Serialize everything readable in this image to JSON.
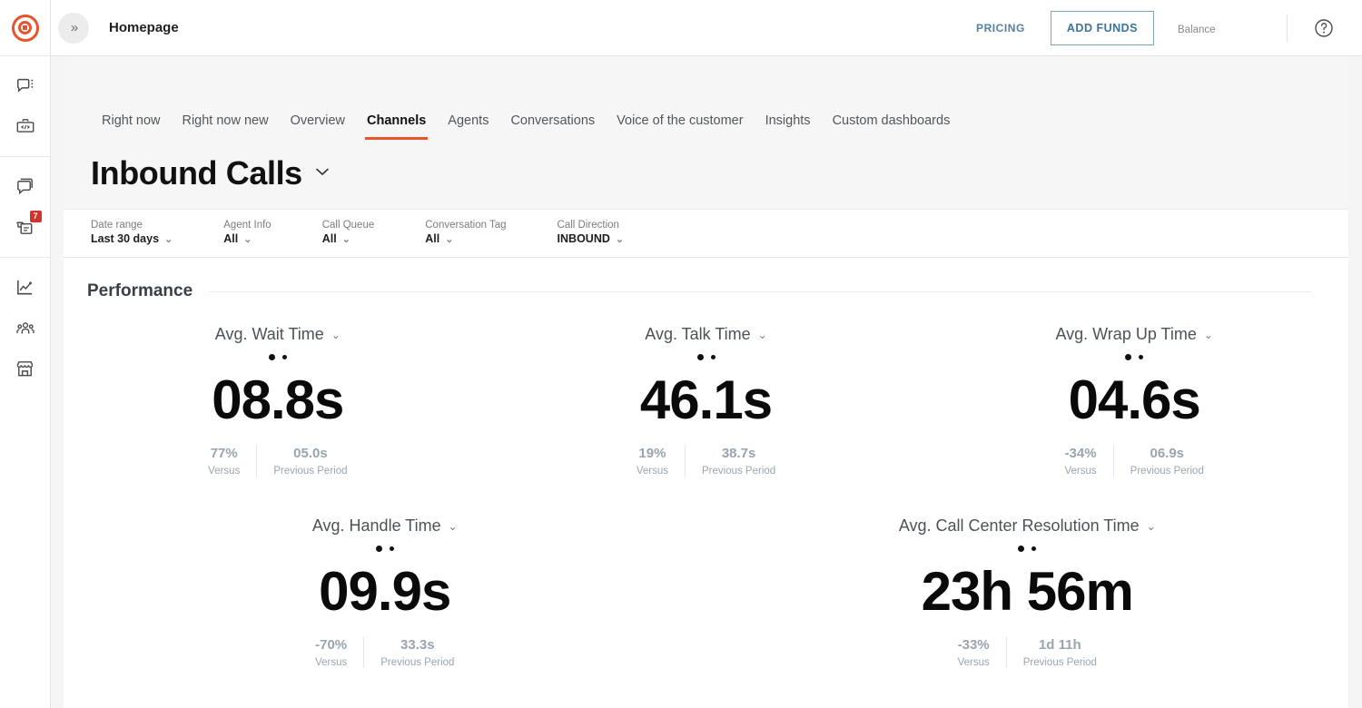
{
  "rail": {
    "logo": "target-logo",
    "groups": [
      {
        "items": [
          {
            "name": "chat-menu-icon",
            "icon": "chat-bubble-dots"
          },
          {
            "name": "developer-tools-icon",
            "icon": "briefcase-code"
          }
        ]
      },
      {
        "items": [
          {
            "name": "conversations-icon",
            "icon": "duplicate-chat"
          },
          {
            "name": "tickets-icon",
            "icon": "document-minus",
            "badge": "7"
          }
        ]
      },
      {
        "items": [
          {
            "name": "analytics-icon",
            "icon": "line-chart"
          },
          {
            "name": "team-icon",
            "icon": "people-group"
          },
          {
            "name": "marketplace-icon",
            "icon": "storefront"
          }
        ]
      }
    ]
  },
  "topbar": {
    "collapse_icon": "double-chevron-right",
    "breadcrumb": "Homepage",
    "pricing_label": "PRICING",
    "add_funds_label": "ADD FUNDS",
    "balance_label": "Balance",
    "balance_value": "",
    "help_icon": "question-circle",
    "accent_color": "#e8542a",
    "link_color": "#56829f"
  },
  "tabs": [
    {
      "label": "Right now",
      "active": false
    },
    {
      "label": "Right now new",
      "active": false
    },
    {
      "label": "Overview",
      "active": false
    },
    {
      "label": "Channels",
      "active": true
    },
    {
      "label": "Agents",
      "active": false
    },
    {
      "label": "Conversations",
      "active": false
    },
    {
      "label": "Voice of the customer",
      "active": false
    },
    {
      "label": "Insights",
      "active": false
    },
    {
      "label": "Custom dashboards",
      "active": false
    }
  ],
  "page": {
    "title": "Inbound Calls",
    "title_chevron": "chevron-down"
  },
  "filters": [
    {
      "label": "Date range",
      "value": "Last 30 days"
    },
    {
      "label": "Agent Info",
      "value": "All"
    },
    {
      "label": "Call Queue",
      "value": "All"
    },
    {
      "label": "Conversation Tag",
      "value": "All"
    },
    {
      "label": "Call Direction",
      "value": "INBOUND"
    }
  ],
  "performance": {
    "section_title": "Performance",
    "compare_versus_label": "Versus",
    "compare_previous_label": "Previous Period",
    "row1": [
      {
        "title": "Avg. Wait Time",
        "value": "08.8s",
        "change": "77%",
        "previous": "05.0s"
      },
      {
        "title": "Avg. Talk Time",
        "value": "46.1s",
        "change": "19%",
        "previous": "38.7s"
      },
      {
        "title": "Avg. Wrap Up Time",
        "value": "04.6s",
        "change": "-34%",
        "previous": "06.9s"
      }
    ],
    "row2": [
      {
        "title": "Avg. Handle Time",
        "value": "09.9s",
        "change": "-70%",
        "previous": "33.3s"
      },
      {
        "title": "Avg. Call Center Resolution Time",
        "value": "23h 56m",
        "change": "-33%",
        "previous": "1d 11h"
      }
    ]
  }
}
